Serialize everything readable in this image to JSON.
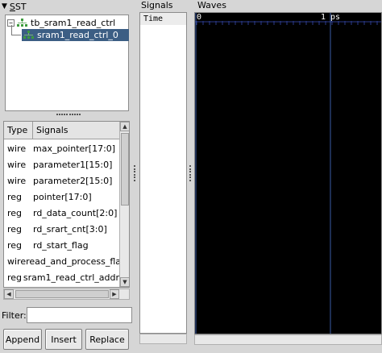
{
  "sst": {
    "title_prefix": "S",
    "title_rest": "ST",
    "tree": [
      {
        "label": "tb_sram1_read_ctrl",
        "expander": "−",
        "selected": false
      },
      {
        "label": "sram1_read_ctrl_0",
        "selected": true
      }
    ]
  },
  "signals_table": {
    "headers": {
      "type": "Type",
      "signals": "Signals"
    },
    "rows": [
      {
        "type": "wire",
        "name": "max_pointer[17:0]"
      },
      {
        "type": "wire",
        "name": "parameter1[15:0]"
      },
      {
        "type": "wire",
        "name": "parameter2[15:0]"
      },
      {
        "type": "reg",
        "name": "pointer[17:0]"
      },
      {
        "type": "reg",
        "name": "rd_data_count[2:0]"
      },
      {
        "type": "reg",
        "name": "rd_srart_cnt[3:0]"
      },
      {
        "type": "reg",
        "name": "rd_start_flag"
      },
      {
        "type": "wire",
        "name": "read_and_process_fla"
      },
      {
        "type": "reg",
        "name": "sram1_read_ctrl_addr"
      }
    ]
  },
  "filter": {
    "label": "Filter:",
    "value": ""
  },
  "buttons": {
    "append": "Append",
    "insert": "Insert",
    "replace": "Replace"
  },
  "signals_pane": {
    "title": "Signals",
    "time_label": "Time"
  },
  "waves_pane": {
    "title": "Waves",
    "start_label": "0",
    "marker_label": "1 ps"
  },
  "colors": {
    "selection": "#3c5e84",
    "waves_bg": "#000000",
    "grid": "#2b3a8c",
    "cursor": "#3a5ba8"
  }
}
